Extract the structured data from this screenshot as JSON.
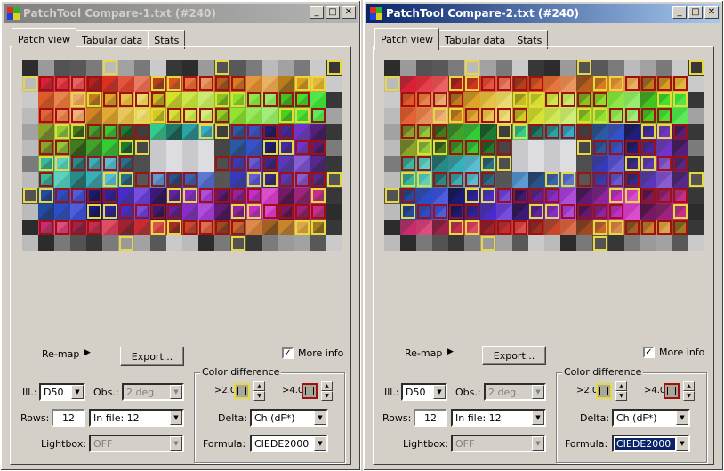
{
  "windows": [
    {
      "title": "PatchTool Compare-1.txt (#240)",
      "active": false,
      "tabs": [
        "Patch view",
        "Tabular data",
        "Stats"
      ],
      "remap_label": "Re-map",
      "export_label": "Export...",
      "more_info_label": "More info",
      "more_info_checked": "✓",
      "ill_label": "Ill.:",
      "ill_value": "D50",
      "obs_label": "Obs.:",
      "obs_value": "2 deg.",
      "rows_label": "Rows:",
      "rows_value": "12",
      "infile_value": "In file: 12",
      "lightbox_label": "Lightbox:",
      "lightbox_value": "OFF",
      "color_diff_title": "Color difference",
      "gt2_label": ">2.0",
      "gt4_label": ">4.0",
      "delta_label": "Delta:",
      "delta_value": "Ch (dF*)",
      "formula_label": "Formula:",
      "formula_value": "CIEDE2000"
    },
    {
      "title": "PatchTool Compare-2.txt (#240)",
      "active": true,
      "tabs": [
        "Patch view",
        "Tabular data",
        "Stats"
      ],
      "remap_label": "Re-map",
      "export_label": "Export...",
      "more_info_label": "More info",
      "more_info_checked": "✓",
      "ill_label": "Ill.:",
      "ill_value": "D50",
      "obs_label": "Obs.:",
      "obs_value": "2 deg.",
      "rows_label": "Rows:",
      "rows_value": "12",
      "infile_value": "In file: 12",
      "lightbox_label": "Lightbox:",
      "lightbox_value": "OFF",
      "color_diff_title": "Color difference",
      "gt2_label": ">2.0",
      "gt4_label": ">4.0",
      "delta_label": "Delta:",
      "delta_value": "Ch (dF*)",
      "formula_label": "Formula:",
      "formula_value": "CIEDE2000"
    }
  ],
  "icons": {
    "titlebar_buttons": [
      "minimize-icon",
      "maximize-icon",
      "close-icon"
    ],
    "remap_arrow": "triangle-right-icon",
    "dropdown": "chevron-down-icon",
    "spin": [
      "spin-up-icon",
      "spin-down-icon"
    ]
  },
  "colors": {
    "threshold_low_swatch": "#a8a89a",
    "threshold_high_swatch": "#a8a89a",
    "highlight_low": "#e8d840",
    "highlight_high": "#a01010",
    "active_title": "#0a246a",
    "inactive_title": "#808080"
  },
  "patch_grid": {
    "rows": 12,
    "cols": 20,
    "total": 240
  }
}
